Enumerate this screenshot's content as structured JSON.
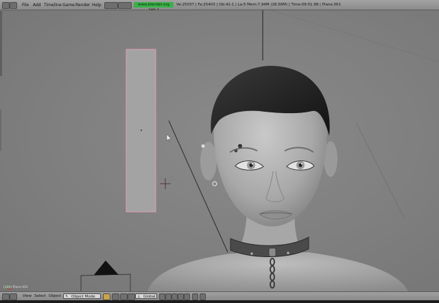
{
  "top_menu": {
    "items": [
      "File",
      "Add",
      "Timeline",
      "Game",
      "Render",
      "Help"
    ],
    "website": "www.blender.org 249.2",
    "stats": "Ve:25037 | Fa:25403 | Ob:42-1 | La:5   Mem:7.94M (28.56M) | Time:09:51.98 | Plane.001"
  },
  "viewport": {
    "object_info": "(240) Plane.001"
  },
  "bottom_bar": {
    "menus": [
      "View",
      "Select",
      "Object"
    ],
    "mode": "Object Mode",
    "orientation": "Global"
  },
  "icons": {
    "mode": "cursor-arrow-icon",
    "orientation": "axes-icon"
  },
  "colors": {
    "header": "#9a9a9a",
    "viewport": "#7f7f7f",
    "website_badge": "#3bb04b"
  }
}
